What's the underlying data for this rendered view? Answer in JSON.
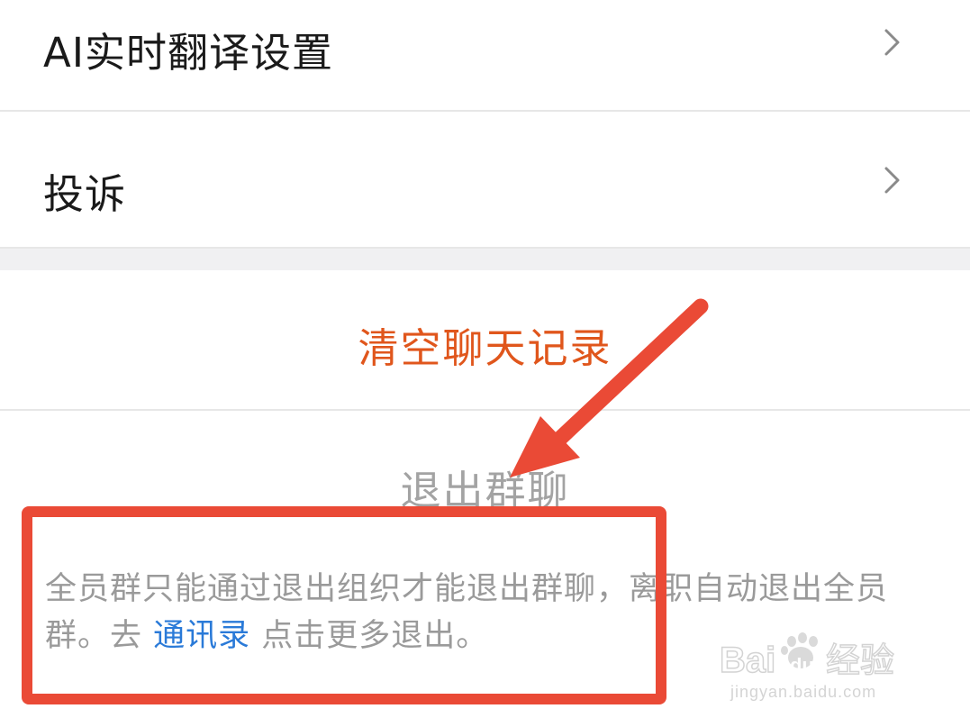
{
  "settings": {
    "items": [
      {
        "label": "AI实时翻译设置",
        "chevron_icon": "chevron-right-icon"
      },
      {
        "label": "投诉",
        "chevron_icon": "chevron-right-icon"
      }
    ]
  },
  "actions": {
    "clear_history_label": "清空聊天记录",
    "exit_group_label": "退出群聊"
  },
  "notice": {
    "text_before": "全员群只能通过退出组织才能退出群聊，离职自动退出全员群。去 ",
    "link_text": "通讯录",
    "text_after": " 点击更多退出。"
  },
  "annotations": {
    "highlight_color": "#ea4a36",
    "arrow_color": "#ea4a36"
  },
  "watermark": {
    "logo_text": "Baidu经验",
    "url": "jingyan.baidu.com"
  },
  "colors": {
    "clear_history": "#e0561c",
    "disabled_text": "#a3a3a3",
    "link": "#2a7ad8",
    "divider": "#e7e7e7",
    "section_gap": "#f0f0f2"
  }
}
